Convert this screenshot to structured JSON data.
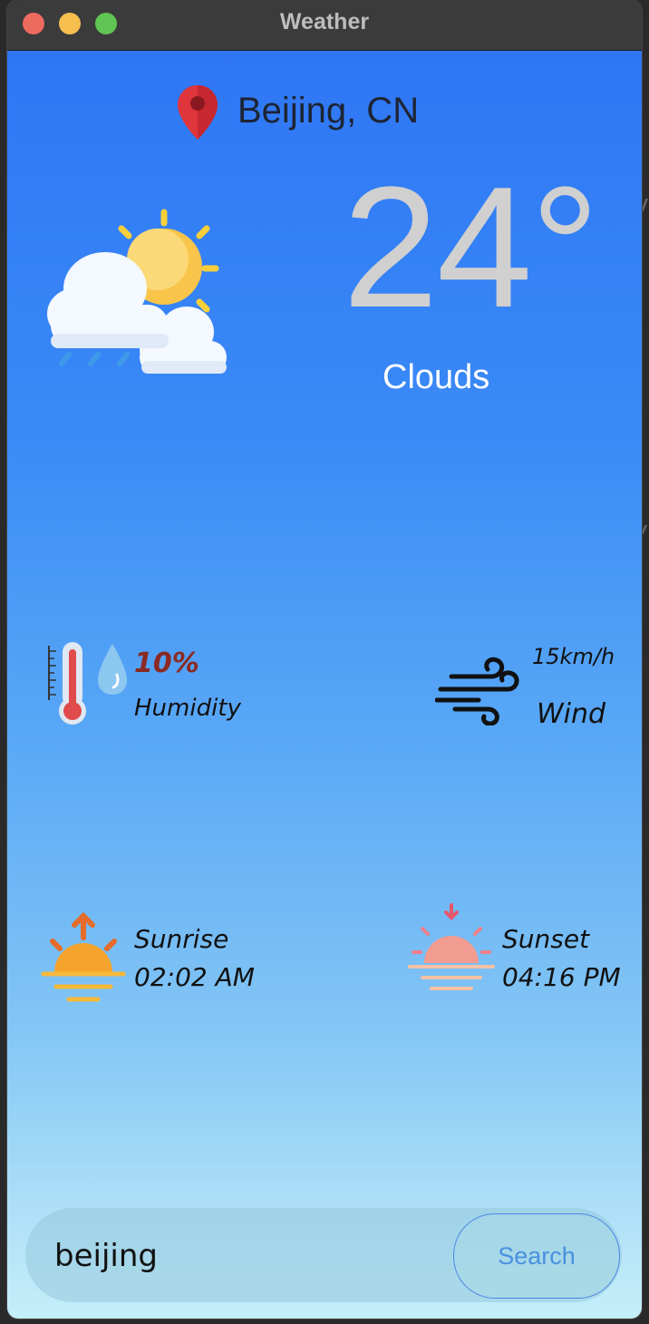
{
  "window": {
    "title": "Weather"
  },
  "location": {
    "label": "Beijing, CN"
  },
  "current": {
    "temperature": "24°",
    "condition": "Clouds"
  },
  "humidity": {
    "value": "10%",
    "label": "Humidity"
  },
  "wind": {
    "value": "15km/h",
    "label": "Wind"
  },
  "sunrise": {
    "label": "Sunrise",
    "time": "02:02 AM"
  },
  "sunset": {
    "label": "Sunset",
    "time": "04:16 PM"
  },
  "search": {
    "value": "beijing",
    "button_label": "Search"
  },
  "icons": {
    "location": "location-pin-icon",
    "weather": "cloud-sun-rain-icon",
    "humidity": "thermometer-droplet-icon",
    "wind": "wind-icon",
    "sunrise": "sunrise-icon",
    "sunset": "sunset-icon"
  },
  "colors": {
    "pin": "#e0353b",
    "humidity_value": "#8b2a22",
    "search_button": "#4a90e2"
  }
}
